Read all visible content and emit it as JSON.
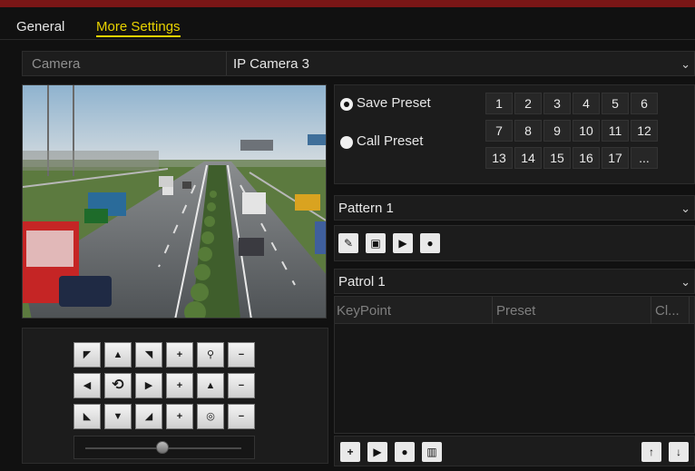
{
  "tabs": [
    {
      "label": "General",
      "active": false
    },
    {
      "label": "More Settings",
      "active": true
    }
  ],
  "camera": {
    "label": "Camera",
    "value": "IP Camera 3"
  },
  "preset": {
    "save_label": "Save Preset",
    "call_label": "Call Preset",
    "selected": "Save Preset",
    "numbers": [
      "1",
      "2",
      "3",
      "4",
      "5",
      "6",
      "7",
      "8",
      "9",
      "10",
      "11",
      "12",
      "13",
      "14",
      "15",
      "16",
      "17",
      "..."
    ]
  },
  "pattern": {
    "selected": "Pattern 1"
  },
  "patrol": {
    "selected": "Patrol 1",
    "columns": [
      "KeyPoint",
      "Preset",
      "Cl..."
    ]
  },
  "colors": {
    "accent": "#e8d200",
    "topbar": "#7a1616",
    "panel": "#1c1c1c"
  }
}
